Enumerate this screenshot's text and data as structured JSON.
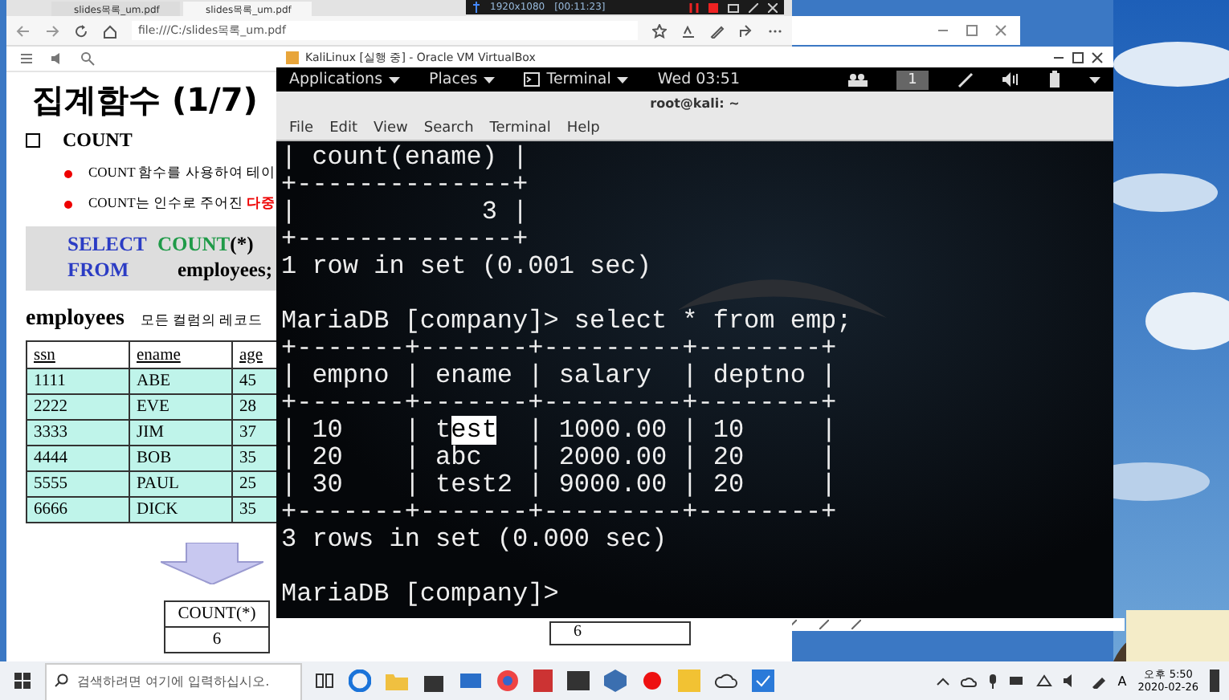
{
  "recorder": {
    "resolution": "1920x1080",
    "elapsed": "[00:11:23]"
  },
  "browser": {
    "tabs": [
      {
        "title": "slides목록_um.pdf",
        "selected": false
      },
      {
        "title": "slides목록_um.pdf",
        "selected": true
      }
    ],
    "url": "file:///C:/slides목록_um.pdf"
  },
  "slide": {
    "title": "집계함수 (1/7)",
    "heading": "COUNT",
    "bullets": [
      {
        "text": "COUNT  함수를 사용하여 테이"
      },
      {
        "text": "COUNT는 인수로 주어진 ",
        "highlight": "다중"
      }
    ],
    "sql": [
      {
        "keyword": "SELECT",
        "function": "COUNT",
        "rest": "(*)"
      },
      {
        "keyword": "FROM",
        "rest": "employees;"
      }
    ],
    "table_name": "employees",
    "note": "모든 컬럼의 레코드",
    "table": {
      "columns": [
        "ssn",
        "ename",
        "age"
      ],
      "rows": [
        [
          "1111",
          "ABE",
          "45"
        ],
        [
          "2222",
          "EVE",
          "28"
        ],
        [
          "3333",
          "JIM",
          "37"
        ],
        [
          "4444",
          "BOB",
          "35"
        ],
        [
          "5555",
          "PAUL",
          "25"
        ],
        [
          "6666",
          "DICK",
          "35"
        ]
      ]
    },
    "result": {
      "column": "COUNT(*)",
      "value": "6"
    },
    "result_2": {
      "value": "6"
    }
  },
  "vm_window": {
    "title": "KaliLinux [실행 중] - Oracle VM VirtualBox"
  },
  "kali_panel": {
    "menus": [
      "Applications",
      "Places",
      "Terminal"
    ],
    "clock": "Wed 03:51",
    "workspace": "1"
  },
  "terminal": {
    "title": "root@kali: ~",
    "menu": [
      "File",
      "Edit",
      "View",
      "Search",
      "Terminal",
      "Help"
    ],
    "lines": [
      {
        "segments": [
          {
            "text": "| count(ename) |",
            "selected": false
          }
        ]
      },
      {
        "segments": [
          {
            "text": "+--------------+",
            "selected": false
          }
        ]
      },
      {
        "segments": [
          {
            "text": "|            3 |",
            "selected": false
          }
        ]
      },
      {
        "segments": [
          {
            "text": "+--------------+",
            "selected": false
          }
        ]
      },
      {
        "segments": [
          {
            "text": "1 row in set (0.001 sec)",
            "selected": false
          }
        ]
      },
      {
        "kind": "blank"
      },
      {
        "segments": [
          {
            "text": "MariaDB [company]> select * from emp;",
            "selected": false
          }
        ]
      },
      {
        "segments": [
          {
            "text": "+-------+-------+---------+--------+",
            "selected": false
          }
        ]
      },
      {
        "segments": [
          {
            "text": "| empno | ename | salary  | deptno |",
            "selected": false
          }
        ]
      },
      {
        "segments": [
          {
            "text": "+-------+-------+---------+--------+",
            "selected": false
          }
        ]
      },
      {
        "segments": [
          {
            "text": "| 10    | t",
            "selected": false
          },
          {
            "text": "est",
            "selected": true
          },
          {
            "text": "  | 1000.00 | 10     |",
            "selected": false
          }
        ]
      },
      {
        "segments": [
          {
            "text": "| 20    | abc   | 2000.00 | 20     |",
            "selected": false
          }
        ]
      },
      {
        "segments": [
          {
            "text": "| 30    | test2 | 9000.00 | 20     |",
            "selected": false
          }
        ]
      },
      {
        "segments": [
          {
            "text": "+-------+-------+---------+--------+",
            "selected": false
          }
        ]
      },
      {
        "segments": [
          {
            "text": "3 rows in set (0.000 sec)",
            "selected": false
          }
        ]
      },
      {
        "kind": "blank"
      },
      {
        "segments": [
          {
            "text": "MariaDB [company]>",
            "selected": false
          }
        ]
      }
    ]
  },
  "taskbar": {
    "search": {
      "placeholder": "검색하려면 여기에 입력하십시오."
    },
    "ime": "A",
    "time": "오후 5:50",
    "date": "2020-02-26"
  }
}
